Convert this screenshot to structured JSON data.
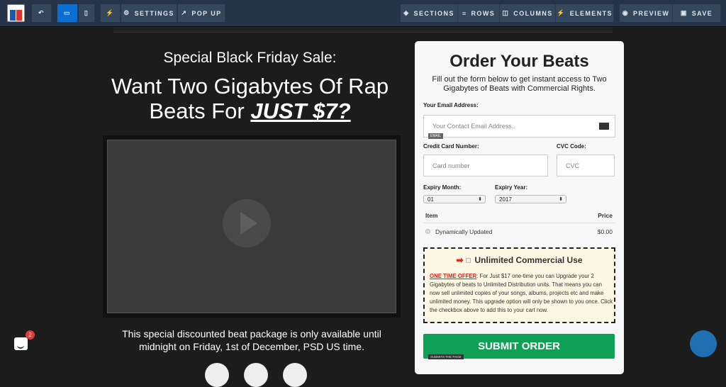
{
  "toolbar": {
    "settings": "SETTINGS",
    "popup": "POP UP",
    "sections": "SECTIONS",
    "rows": "ROWS",
    "columns": "COLUMNS",
    "elements": "ELEMENTS",
    "preview": "PREVIEW",
    "save": "SAVE",
    "active_color": "#0a6fd1"
  },
  "page": {
    "headline1": "Special Black Friday Sale:",
    "headline2a": "Want Two Gigabytes Of Rap",
    "headline2b": "Beats For ",
    "headline2c": "JUST $7?",
    "notice": "This special discounted beat package is only available until midnight on Friday, 1st of December, PSD US time."
  },
  "chat": {
    "badge": "2"
  },
  "form": {
    "title": "Order Your Beats",
    "subtitle": "Fill out the form below to get instant access to Two Gigabytes of Beats with Commercial Rights.",
    "email_label": "Your Email Address:",
    "email_placeholder": "Your Contact Email Address..",
    "email_tag": "EMAIL",
    "card_label": "Credit Card Number:",
    "card_placeholder": "Card number",
    "cvc_label": "CVC Code:",
    "cvc_placeholder": "CVC",
    "month_label": "Expiry Month:",
    "month_value": "01",
    "year_label": "Expiry Year:",
    "year_value": "2017",
    "item_header": "Item",
    "price_header": "Price",
    "item_name": "Dynamically Updated",
    "item_price": "$0.00",
    "offer_title": "Unlimited Commercial Use",
    "offer_lead": "ONE TIME OFFER",
    "offer_text": ": For Just $17 one-time you can Upgrade your 2 Gigabytes of beats to Unlimited Distribution units. That means you can now sell unlimited copies of your songs, albums, projects etc and make unlimited money. This upgrade option will only be shown to you once. Click the checkbox above to add this to your cart now.",
    "submit": "SUBMIT ORDER",
    "submit_tag": "SUBMITS THE PAGE",
    "submit_color": "#0ea156"
  }
}
